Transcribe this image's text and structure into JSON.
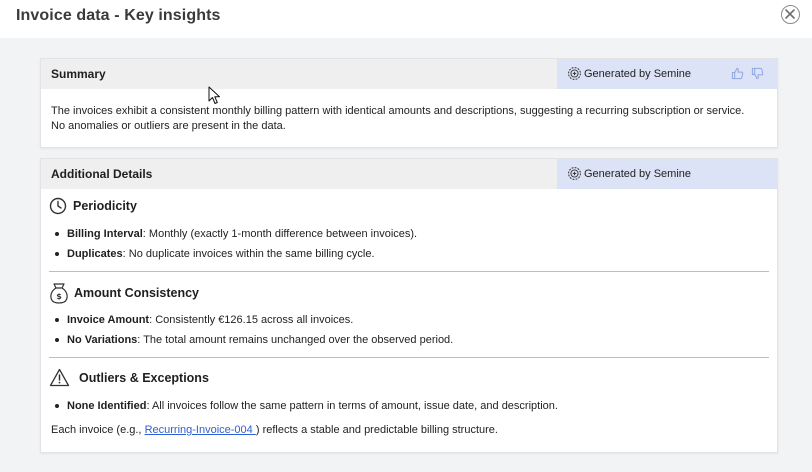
{
  "modal": {
    "title": "Invoice data - Key insights"
  },
  "summary": {
    "title": "Summary",
    "generated_by": "Generated by Semine",
    "text": "The invoices exhibit a consistent monthly billing pattern with identical amounts and descriptions, suggesting a recurring subscription or service. No anomalies or outliers are present in the data."
  },
  "details": {
    "title": "Additional Details",
    "generated_by": "Generated by Semine",
    "periodicity": {
      "heading": "Periodicity",
      "items": [
        {
          "label": "Billing Interval",
          "text": ": Monthly (exactly 1-month difference between invoices)."
        },
        {
          "label": "Duplicates",
          "text": ": No duplicate invoices within the same billing cycle."
        }
      ]
    },
    "amount": {
      "heading": "Amount Consistency",
      "items": [
        {
          "label": "Invoice Amount",
          "text": ": Consistently €126.15 across all invoices."
        },
        {
          "label": "No Variations",
          "text": ": The total amount remains unchanged over the observed period."
        }
      ]
    },
    "outliers": {
      "heading": "Outliers & Exceptions",
      "items": [
        {
          "label": "None Identified",
          "text": ": All invoices follow the same pattern in terms of amount, issue date, and description."
        }
      ]
    },
    "footnote": {
      "prefix": "Each invoice (e.g., ",
      "link": "Recurring-Invoice-004 ",
      "suffix": ") reflects a stable and predictable billing structure."
    }
  },
  "icons": {
    "close": "close-icon",
    "ai": "sparkle-gear-icon",
    "thumbs_up": "thumbs-up-icon",
    "thumbs_down": "thumbs-down-icon",
    "clock": "clock-icon",
    "money_bag": "money-bag-icon",
    "warning": "warning-icon"
  },
  "colors": {
    "badge_bg": "#dde3f7",
    "link": "#2f5fd0",
    "body_bg": "#f2f3f5"
  }
}
